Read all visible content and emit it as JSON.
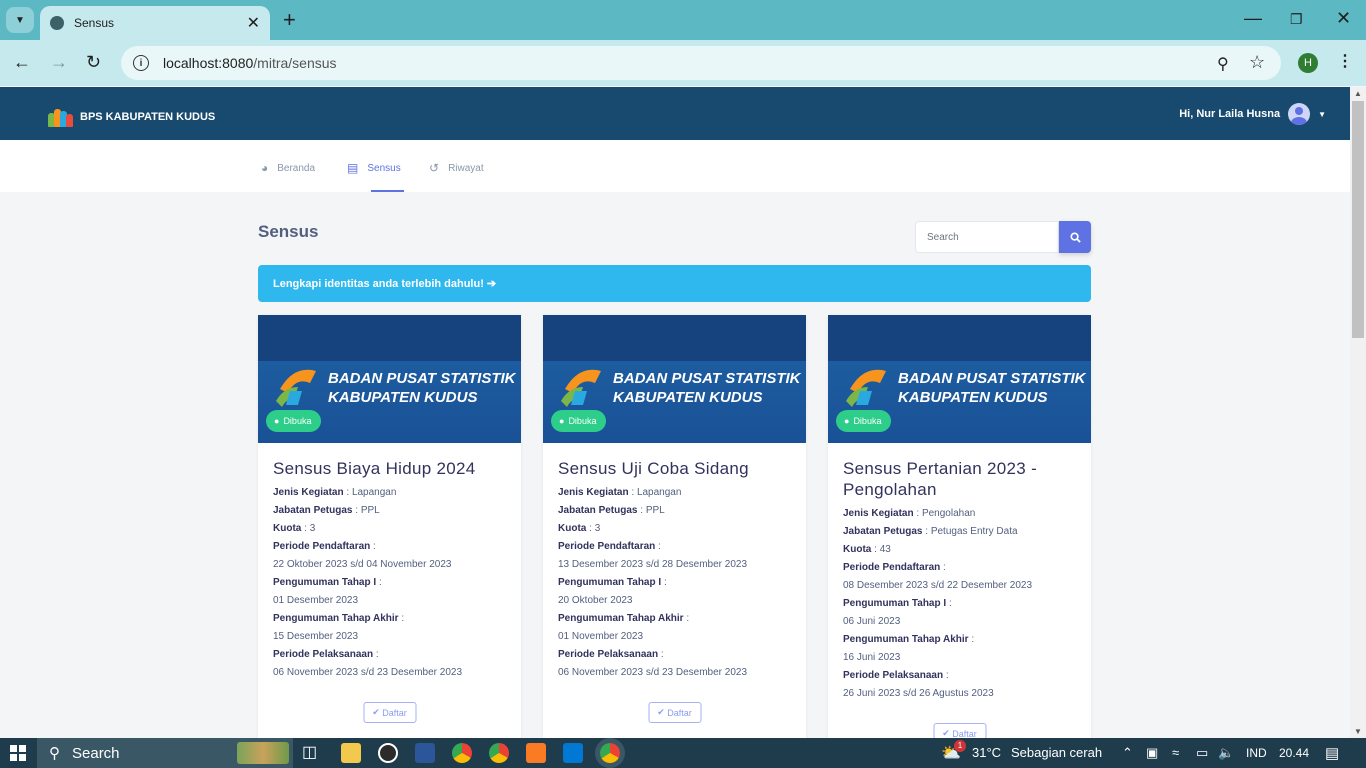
{
  "browser": {
    "tab_title": "Sensus",
    "url_host": "localhost:8080",
    "url_path": "/mitra/sensus",
    "profile_initial": "H"
  },
  "app": {
    "brand": "BPS KABUPATEN KUDUS",
    "greeting": "Hi, Nur Laila Husna",
    "nav": [
      {
        "label": "Beranda",
        "icon": "dashboard-icon"
      },
      {
        "label": "Sensus",
        "icon": "clipboard-icon"
      },
      {
        "label": "Riwayat",
        "icon": "history-icon"
      }
    ],
    "active_nav": "Sensus",
    "page_title": "Sensus",
    "search_placeholder": "Search",
    "alert_text": "Lengkapi identitas anda terlebih dahulu! ➔",
    "banner_line1": "BADAN PUSAT STATISTIK",
    "banner_line2": "KABUPATEN KUDUS",
    "status_badge": "Dibuka",
    "daftar_label": "Daftar",
    "field_labels": {
      "jenis": "Jenis Kegiatan",
      "jabatan": "Jabatan Petugas",
      "kuota": "Kuota",
      "pendaftaran": "Periode Pendaftaran",
      "tahap1": "Pengumuman Tahap I",
      "akhir": "Pengumuman Tahap Akhir",
      "pelaksanaan": "Periode Pelaksanaan"
    },
    "cards": [
      {
        "title": "Sensus Biaya Hidup 2024",
        "jenis": "Lapangan",
        "jabatan": "PPL",
        "kuota": "3",
        "pendaftaran": "22 Oktober 2023 s/d 04 November 2023",
        "tahap1": "01 Desember 2023",
        "akhir": "15 Desember 2023",
        "pelaksanaan": "06 November 2023 s/d 23 Desember 2023"
      },
      {
        "title": "Sensus Uji Coba Sidang",
        "jenis": "Lapangan",
        "jabatan": "PPL",
        "kuota": "3",
        "pendaftaran": "13 Desember 2023 s/d 28 Desember 2023",
        "tahap1": "20 Oktober 2023",
        "akhir": "01 November 2023",
        "pelaksanaan": "06 November 2023 s/d 23 Desember 2023"
      },
      {
        "title": "Sensus Pertanian 2023 - Pengolahan",
        "jenis": "Pengolahan",
        "jabatan": "Petugas Entry Data",
        "kuota": "43",
        "pendaftaran": "08 Desember 2023 s/d 22 Desember 2023",
        "tahap1": "06 Juni 2023",
        "akhir": "16 Juni 2023",
        "pelaksanaan": "26 Juni 2023 s/d 26 Agustus 2023"
      }
    ]
  },
  "taskbar": {
    "search_label": "Search",
    "weather_temp": "31°C",
    "weather_text": "Sebagian cerah",
    "weather_badge": "1",
    "language": "IND",
    "time": "20.44"
  },
  "colors": {
    "topbar": "#174a6e",
    "accent": "#5e72e4",
    "alert": "#2fb8ee",
    "badge": "#2dce89"
  }
}
